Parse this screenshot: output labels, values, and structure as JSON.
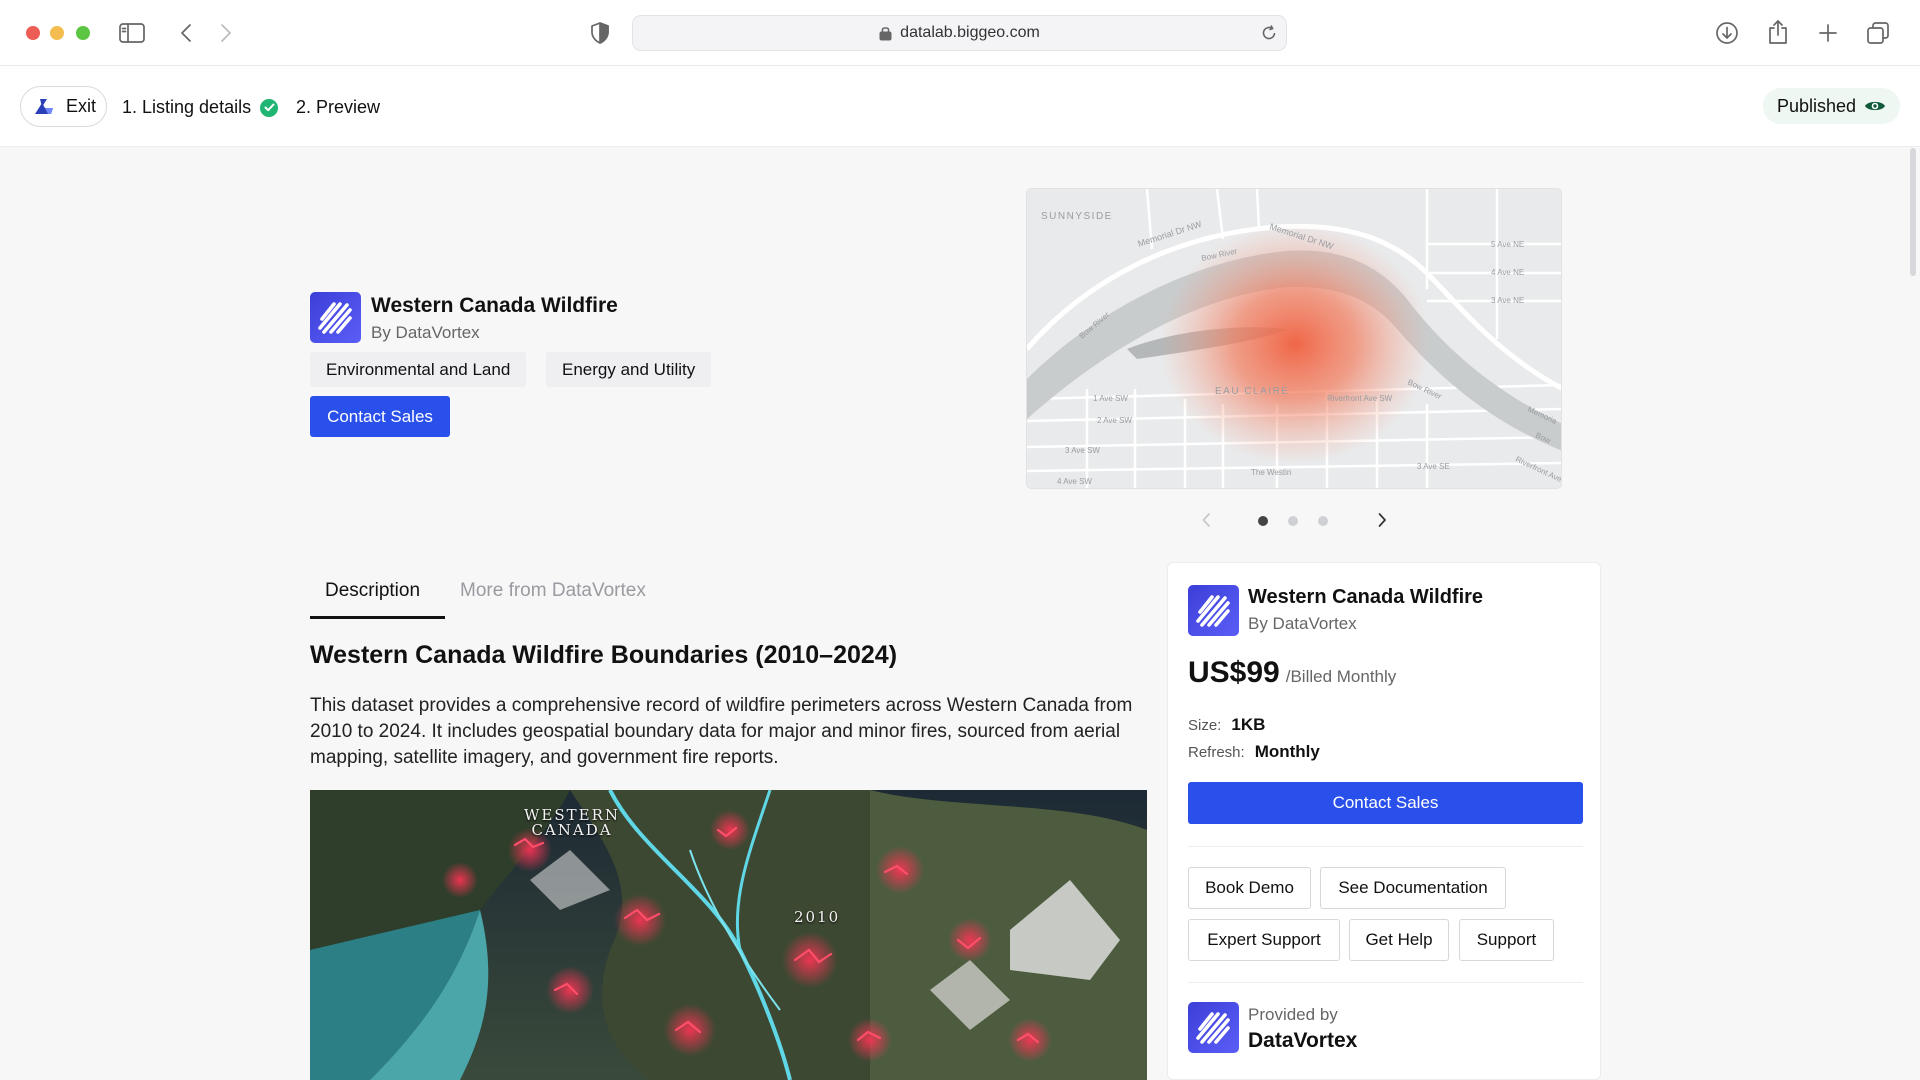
{
  "browser": {
    "url": "datalab.biggeo.com"
  },
  "appbar": {
    "exit_label": "Exit",
    "step1_label": "1. Listing details",
    "step2_label": "2. Preview",
    "status_label": "Published"
  },
  "hero": {
    "title": "Western Canada Wildfire",
    "by": "By DataVortex",
    "tags": [
      "Environmental and Land",
      "Energy and Utility"
    ],
    "cta_label": "Contact Sales",
    "map_labels": {
      "sunnyside": "SUNNYSIDE",
      "eau_claire": "EAU CLAIRE",
      "memorial_nw_1": "Memorial Dr NW",
      "memorial_nw_2": "Memorial Dr NW",
      "bow_river_1": "Bow River",
      "bow_river_2": "Bow River",
      "bow_river_3": "Bow River",
      "ave5": "5 Ave NE",
      "ave4": "4 Ave NE",
      "ave3": "3 Ave NE",
      "sw1": "1 Ave SW",
      "sw2": "2 Ave SW",
      "sw3": "3 Ave SW",
      "sw4": "4 Ave SW",
      "riverfront": "Riverfront Ave SW",
      "westin": "The Westin",
      "se3": "3 Ave SE",
      "memorial_e": "Memoria",
      "bow_e": "Bow",
      "riverfront_e": "Riverfront Ave"
    },
    "carousel": {
      "active_index": 0,
      "count": 3
    }
  },
  "tabs": [
    {
      "label": "Description",
      "active": true
    },
    {
      "label": "More from DataVortex",
      "active": false
    }
  ],
  "content": {
    "heading": "Western Canada Wildfire Boundaries (2010–2024)",
    "body": "This dataset provides a comprehensive record of wildfire perimeters across Western Canada from 2010 to 2024. It includes geospatial boundary data for major and minor fires, sourced from aerial mapping, satellite imagery, and government fire reports.",
    "image_labels": {
      "region": "WESTERN\nCANADA",
      "year": "2010"
    }
  },
  "card": {
    "title": "Western Canada Wildfire",
    "by": "By DataVortex",
    "price": "US$99",
    "billing": "/Billed Monthly",
    "size_label": "Size:",
    "size_value": "1KB",
    "refresh_label": "Refresh:",
    "refresh_value": "Monthly",
    "cta_label": "Contact Sales",
    "buttons": [
      "Book Demo",
      "See Documentation",
      "Expert Support",
      "Get Help",
      "Support"
    ],
    "provided_label": "Provided by",
    "provider_name": "DataVortex"
  },
  "colors": {
    "accent": "#2950ea",
    "brand_logo": "#4549e6",
    "success": "#21b574",
    "heat": "#f06a4a"
  },
  "icons": [
    "sidebar-icon",
    "back-icon",
    "forward-icon",
    "shield-icon",
    "lock-icon",
    "reload-icon",
    "download-icon",
    "share-icon",
    "new-tab-icon",
    "tabs-icon",
    "check-icon",
    "eye-icon",
    "datavortex-logo-icon",
    "chevron-left-icon",
    "chevron-right-icon"
  ]
}
